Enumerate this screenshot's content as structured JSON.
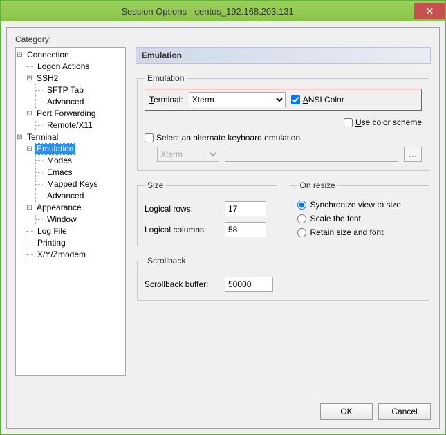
{
  "window": {
    "title": "Session Options - centos_192.168.203.131"
  },
  "category_label": "Category:",
  "tree": {
    "connection": "Connection",
    "logon_actions": "Logon Actions",
    "ssh2": "SSH2",
    "sftp_tab": "SFTP Tab",
    "advanced": "Advanced",
    "port_forwarding": "Port Forwarding",
    "remote_x11": "Remote/X11",
    "terminal": "Terminal",
    "emulation": "Emulation",
    "modes": "Modes",
    "emacs": "Emacs",
    "mapped_keys": "Mapped Keys",
    "advanced2": "Advanced",
    "appearance": "Appearance",
    "window": "Window",
    "log_file": "Log File",
    "printing": "Printing",
    "xyz": "X/Y/Zmodem"
  },
  "panel": {
    "title": "Emulation",
    "emu_group": "Emulation",
    "terminal_label": "Terminal:",
    "terminal_value": "Xterm",
    "ansi_color": "ANSI Color",
    "use_color_scheme": "Use color scheme",
    "select_alt": "Select an alternate keyboard emulation",
    "alt_value": "Xterm",
    "size_group": "Size",
    "logical_rows": "Logical rows:",
    "logical_rows_val": "17",
    "logical_cols": "Logical columns:",
    "logical_cols_val": "58",
    "resize_group": "On resize",
    "resize_sync": "Synchronize view to size",
    "resize_scale": "Scale the font",
    "resize_retain": "Retain size and font",
    "scrollback_group": "Scrollback",
    "scrollback_label": "Scrollback buffer:",
    "scrollback_val": "50000"
  },
  "buttons": {
    "ok": "OK",
    "cancel": "Cancel"
  }
}
